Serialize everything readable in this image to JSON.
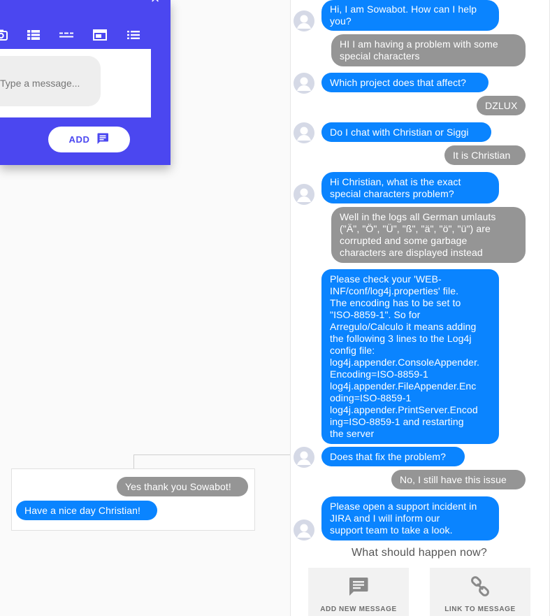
{
  "editor": {
    "close_glyph": "×",
    "toolbar_tools": [
      "camera-icon",
      "table-icon",
      "divider-icon",
      "card-icon",
      "list-icon"
    ],
    "message_placeholder": "Type a message...",
    "add_label": "ADD"
  },
  "node": {
    "messages": [
      {
        "role": "user",
        "text": "Yes thank you Sowabot!"
      },
      {
        "role": "bot",
        "text": "Have a nice day Christian!"
      }
    ]
  },
  "chat": {
    "messages": [
      {
        "role": "bot",
        "text": "Hi, I am Sowabot. How can I help\nyou?"
      },
      {
        "role": "user",
        "text": "HI I am having a problem with some\nspecial characters"
      },
      {
        "role": "bot",
        "text": "Which project does that affect?"
      },
      {
        "role": "user",
        "text": "DZLUX"
      },
      {
        "role": "bot",
        "text": "Do I chat with Christian or Siggi"
      },
      {
        "role": "user",
        "text": "It is Christian"
      },
      {
        "role": "bot",
        "text": "Hi Christian, what is the exact\nspecial characters problem?"
      },
      {
        "role": "user",
        "text": "Well in the logs all German umlauts\n(\"Ä\", \"Ö\", \"Ü\", \"ß\", \"ä\", \"ö\", \"ü\")  are\ncorrupted and some garbage\ncharacters are displayed instead"
      },
      {
        "role": "bot",
        "text": "Please check your 'WEB-\nINF/conf/log4j.properties' file.\nThe encoding has to be set to\n\"ISO-8859-1\". So for\nArregulo/Calculo it means adding\nthe following 3 lines to the Log4j\nconfig file:\nlog4j.appender.ConsoleAppender.\nEncoding=ISO-8859-1\nlog4j.appender.FileAppender.Enc\noding=ISO-8859-1\nlog4j.appender.PrintServer.Encod\ning=ISO-8859-1 and restarting\nthe server"
      },
      {
        "role": "bot",
        "text": "Does that fix the problem?"
      },
      {
        "role": "user",
        "text": "No, I still have this issue"
      },
      {
        "role": "bot",
        "text": "Please open a support incident in\nJIRA and I will inform our\nsupport team to take a look."
      }
    ],
    "question": "What should happen now?",
    "actions": [
      {
        "label": "ADD NEW MESSAGE",
        "icon": "message-icon"
      },
      {
        "label": "LINK TO MESSAGE",
        "icon": "link-icon"
      }
    ]
  },
  "colors": {
    "editor_bg": "#4b47f0",
    "bot_bubble": "#0a84ff",
    "user_bubble": "#959595"
  }
}
